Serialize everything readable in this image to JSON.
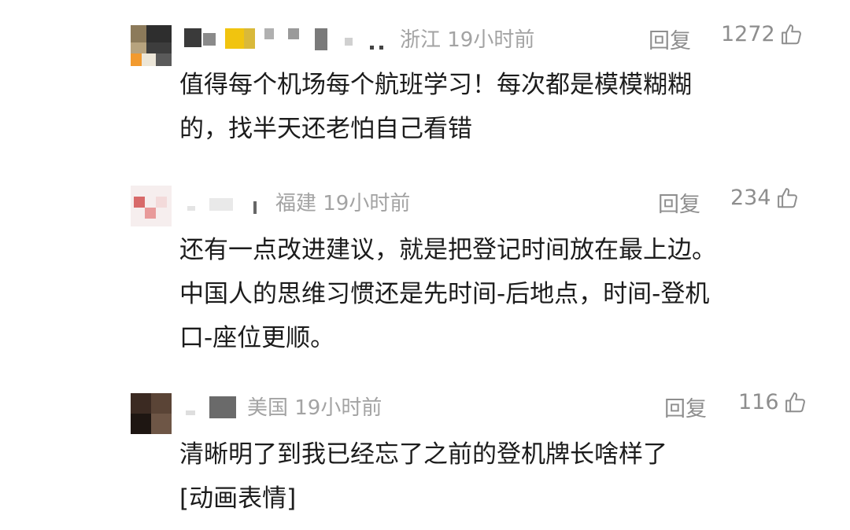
{
  "colors": {
    "text": "#1c1c1c",
    "meta": "#a3a3a3",
    "action": "#8e8e8e",
    "background": "#ffffff"
  },
  "comments": [
    {
      "location_time": "浙江 19小时前",
      "reply_label": "回复",
      "likes": "1272",
      "like_icon": "thumbs-up-icon",
      "lines": [
        "值得每个机场每个航班学习！每次都是模模糊糊",
        "的，找半天还老怕自己看错"
      ]
    },
    {
      "location_time": "福建 19小时前",
      "reply_label": "回复",
      "likes": "234",
      "like_icon": "thumbs-up-icon",
      "lines": [
        "还有一点改进建议，就是把登记时间放在最上边。",
        "中国人的思维习惯还是先时间-后地点，时间-登机",
        "口-座位更顺。"
      ]
    },
    {
      "location_time": "美国 19小时前",
      "reply_label": "回复",
      "likes": "116",
      "like_icon": "thumbs-up-icon",
      "lines": [
        "清晰明了到我已经忘了之前的登机牌长啥样了",
        "[动画表情]"
      ]
    }
  ]
}
